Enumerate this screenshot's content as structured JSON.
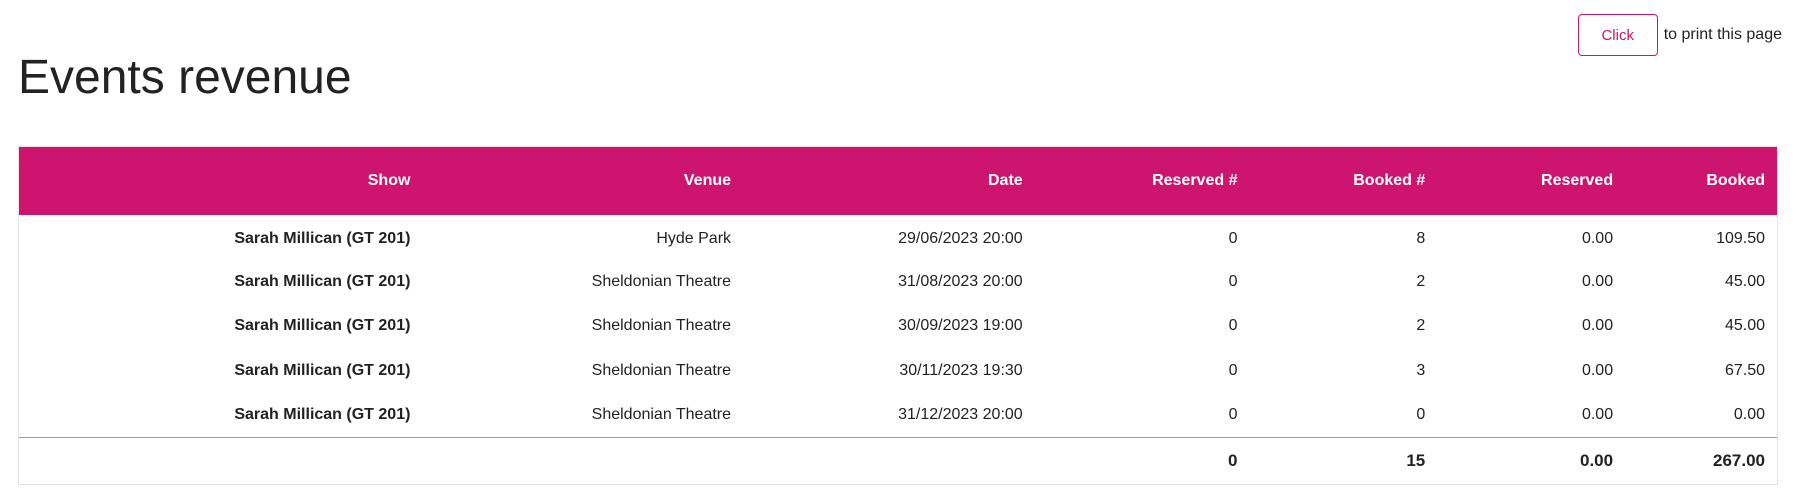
{
  "print": {
    "button_label": "Click",
    "suffix": "to print this page"
  },
  "page": {
    "title": "Events revenue"
  },
  "table": {
    "headers": {
      "show": "Show",
      "venue": "Venue",
      "date": "Date",
      "reserved_count": "Reserved #",
      "booked_count": "Booked #",
      "reserved": "Reserved",
      "booked": "Booked"
    },
    "rows": [
      {
        "show": "Sarah Millican (GT 201)",
        "venue": "Hyde Park",
        "date": "29/06/2023 20:00",
        "reserved_count": "0",
        "booked_count": "8",
        "reserved": "0.00",
        "booked": "109.50"
      },
      {
        "show": "Sarah Millican (GT 201)",
        "venue": "Sheldonian Theatre",
        "date": "31/08/2023 20:00",
        "reserved_count": "0",
        "booked_count": "2",
        "reserved": "0.00",
        "booked": "45.00"
      },
      {
        "show": "Sarah Millican (GT 201)",
        "venue": "Sheldonian Theatre",
        "date": "30/09/2023 19:00",
        "reserved_count": "0",
        "booked_count": "2",
        "reserved": "0.00",
        "booked": "45.00"
      },
      {
        "show": "Sarah Millican (GT 201)",
        "venue": "Sheldonian Theatre",
        "date": "30/11/2023 19:30",
        "reserved_count": "0",
        "booked_count": "3",
        "reserved": "0.00",
        "booked": "67.50"
      },
      {
        "show": "Sarah Millican (GT 201)",
        "venue": "Sheldonian Theatre",
        "date": "31/12/2023 20:00",
        "reserved_count": "0",
        "booked_count": "0",
        "reserved": "0.00",
        "booked": "0.00"
      }
    ],
    "totals": {
      "reserved_count": "0",
      "booked_count": "15",
      "reserved": "0.00",
      "booked": "267.00"
    }
  },
  "colors": {
    "accent": "#cd1570",
    "header_text": "#ffffff",
    "body_text": "#222222"
  }
}
